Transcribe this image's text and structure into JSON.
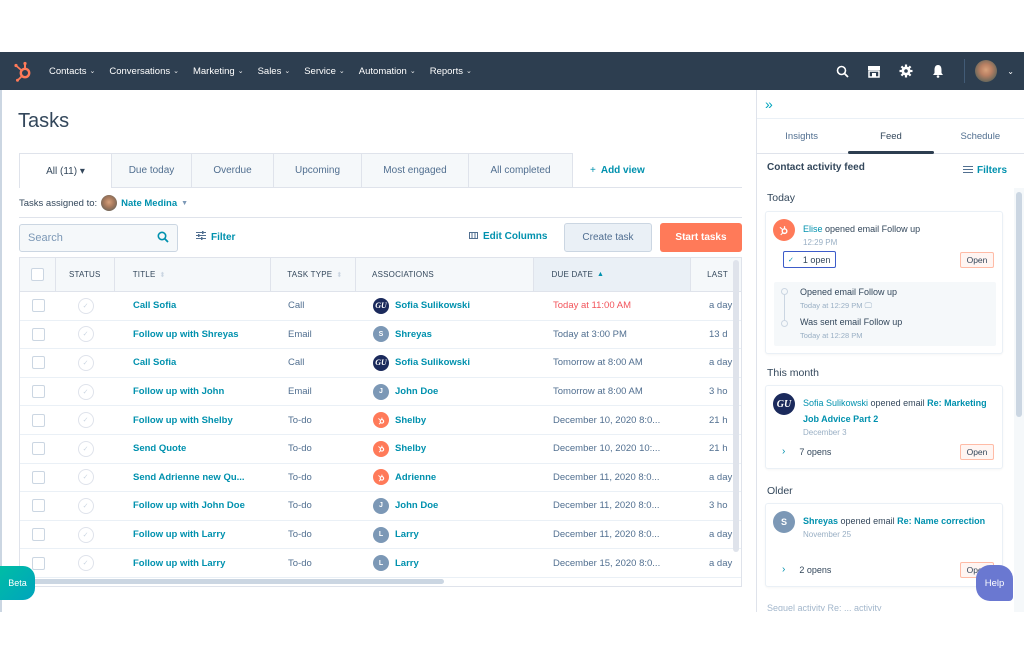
{
  "nav": {
    "items": [
      "Contacts",
      "Conversations",
      "Marketing",
      "Sales",
      "Service",
      "Automation",
      "Reports"
    ],
    "icons": [
      "search-icon",
      "marketplace-icon",
      "settings-icon",
      "notifications-icon"
    ],
    "brand_color": "#ff7a59",
    "bg_color": "#2d3e50"
  },
  "page": {
    "title": "Tasks",
    "tabs": [
      "All (11) ▾",
      "Due today",
      "Overdue",
      "Upcoming",
      "Most engaged",
      "All completed"
    ],
    "add_view": "Add view",
    "assigned_label": "Tasks assigned to:",
    "assigned_user": "Nate Medina",
    "search_placeholder": "Search",
    "filter_label": "Filter",
    "edit_columns_label": "Edit Columns",
    "create_task_label": "Create task",
    "start_tasks_label": "Start tasks"
  },
  "table": {
    "headers": [
      "STATUS",
      "TITLE",
      "TASK TYPE",
      "ASSOCIATIONS",
      "DUE DATE",
      "LAST"
    ],
    "rows": [
      {
        "title": "Call Sofia",
        "type": "Call",
        "assoc": "Sofia Sulikowski",
        "assoc_avatar": "GU",
        "due": "Today at 11:00 AM",
        "due_overdue": true,
        "last": "a day"
      },
      {
        "title": "Follow up with Shreyas",
        "type": "Email",
        "assoc": "Shreyas",
        "assoc_avatar": "S",
        "due": "Today at 3:00 PM",
        "due_overdue": false,
        "last": "13 d"
      },
      {
        "title": "Call Sofia",
        "type": "Call",
        "assoc": "Sofia Sulikowski",
        "assoc_avatar": "GU",
        "due": "Tomorrow at 8:00 AM",
        "due_overdue": false,
        "last": "a day"
      },
      {
        "title": "Follow up with John",
        "type": "Email",
        "assoc": "John Doe",
        "assoc_avatar": "J",
        "due": "Tomorrow at 8:00 AM",
        "due_overdue": false,
        "last": "3 ho"
      },
      {
        "title": "Follow up with Shelby",
        "type": "To-do",
        "assoc": "Shelby",
        "assoc_avatar": "HS",
        "due": "December 10, 2020 8:0...",
        "due_overdue": false,
        "last": "21 h"
      },
      {
        "title": "Send Quote",
        "type": "To-do",
        "assoc": "Shelby",
        "assoc_avatar": "HS",
        "due": "December 10, 2020 10:...",
        "due_overdue": false,
        "last": "21 h"
      },
      {
        "title": "Send Adrienne new Qu...",
        "type": "To-do",
        "assoc": "Adrienne",
        "assoc_avatar": "HS",
        "due": "December 11, 2020 8:0...",
        "due_overdue": false,
        "last": "a day"
      },
      {
        "title": "Follow up with John Doe",
        "type": "To-do",
        "assoc": "John Doe",
        "assoc_avatar": "J",
        "due": "December 11, 2020 8:0...",
        "due_overdue": false,
        "last": "3 ho"
      },
      {
        "title": "Follow up with Larry",
        "type": "To-do",
        "assoc": "Larry",
        "assoc_avatar": "L",
        "due": "December 11, 2020 8:0...",
        "due_overdue": false,
        "last": "a day"
      },
      {
        "title": "Follow up with Larry",
        "type": "To-do",
        "assoc": "Larry",
        "assoc_avatar": "L",
        "due": "December 15, 2020 8:0...",
        "due_overdue": false,
        "last": "a day"
      }
    ]
  },
  "beta_label": "Beta",
  "help_label": "Help",
  "sidebar": {
    "tabs": [
      "Insights",
      "Feed",
      "Schedule"
    ],
    "active_tab": "Feed",
    "feed_title": "Contact activity feed",
    "filters_label": "Filters",
    "sections": {
      "today": "Today",
      "this_month": "This month",
      "older": "Older"
    },
    "cards": [
      {
        "actor": "Elise",
        "action": "opened email Follow up",
        "time": "12:29 PM",
        "opens": "1 open",
        "open_btn": "Open",
        "timeline": [
          {
            "text": "Opened email Follow up",
            "time": "Today at 12:29 PM"
          },
          {
            "text": "Was sent email Follow up",
            "time": "Today at 12:28 PM"
          }
        ]
      },
      {
        "actor": "Sofia Sulikowski",
        "action": "opened email",
        "subject": "Re: Marketing Job Advice Part 2",
        "time": "December 3",
        "opens": "7 opens",
        "open_btn": "Open"
      },
      {
        "actor": "Shreyas",
        "action": "opened email",
        "subject": "Re: Name correction",
        "time": "November 25",
        "opens": "2 opens",
        "open_btn": "Open"
      }
    ],
    "cutoff_text": "Sequel activity   Re:   ... activity"
  }
}
